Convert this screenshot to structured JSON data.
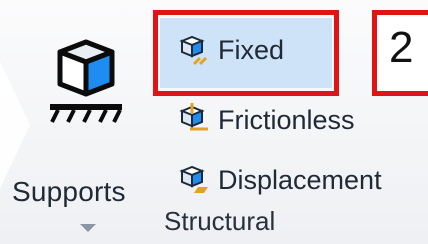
{
  "supports": {
    "label": "Supports"
  },
  "menu": {
    "items": [
      {
        "label": "Fixed"
      },
      {
        "label": "Frictionless"
      },
      {
        "label": "Displacement"
      }
    ]
  },
  "annotation": {
    "badge": "2"
  },
  "group": {
    "label": "Structural"
  },
  "colors": {
    "highlight_border": "#e01414",
    "selection_fill": "#cfe3f8",
    "cube_blue": "#1e8cf0",
    "accent_orange": "#e0a326"
  }
}
